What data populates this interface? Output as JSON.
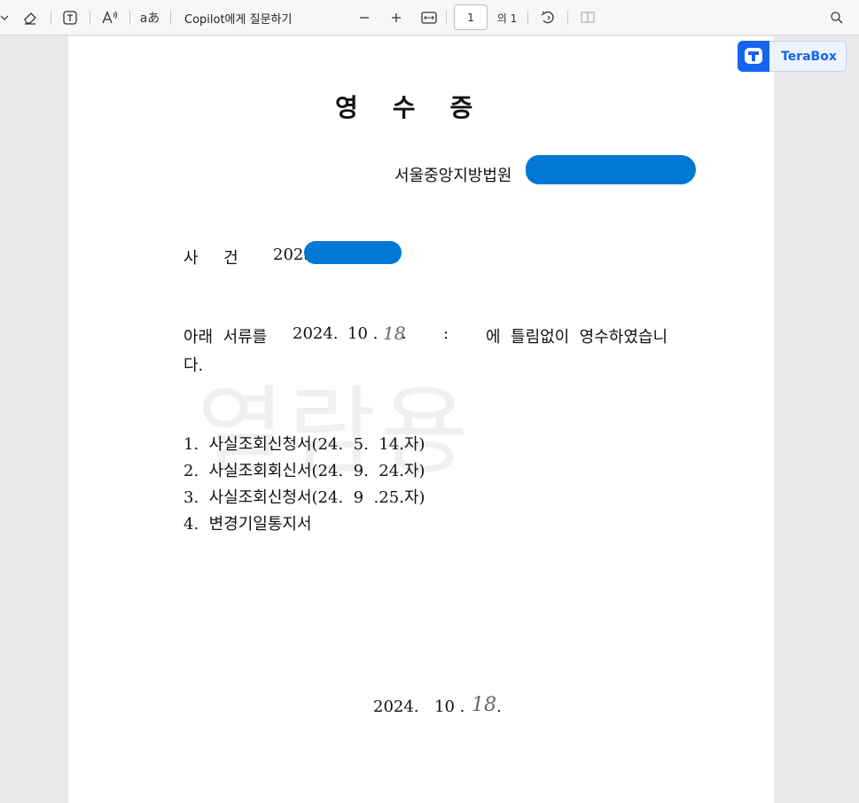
{
  "toolbar": {
    "copilot_label": "Copilot에게 질문하기",
    "page_number": "1",
    "page_of": "의 1",
    "icons": [
      "eraser-icon",
      "text-box-icon",
      "read-aloud-icon",
      "translate-icon",
      "zoom-out-icon",
      "zoom-in-icon",
      "fit-width-icon",
      "rotate-icon",
      "two-page-icon",
      "search-icon"
    ]
  },
  "terabox": {
    "label": "TeraBox"
  },
  "document": {
    "title": "영    수    증",
    "court": "서울중앙지방법원",
    "case_label": "사     건",
    "case_number": "2023",
    "receipt_line1_a": "아래  서류를",
    "receipt_date_year": "2024.",
    "receipt_date_month": "10 .",
    "receipt_date_day_handwritten": "18",
    "receipt_colon": ":",
    "receipt_line1_b": "에  틀림없이  영수하였습니",
    "receipt_line2": "다.",
    "items": [
      "1.  사실조회신청서(24.  5.  14.자)",
      "2.  사실조회회신서(24.  9.  24.자)",
      "3.  사실조회신청서(24.  9  .25.자)",
      "4.  변경기일통지서"
    ],
    "footer_year": "2024.",
    "footer_month": "10 .",
    "footer_day_handwritten": "18",
    "watermark": "열람용"
  },
  "colors": {
    "redaction": "#0078d4",
    "terabox": "#1664f0"
  }
}
